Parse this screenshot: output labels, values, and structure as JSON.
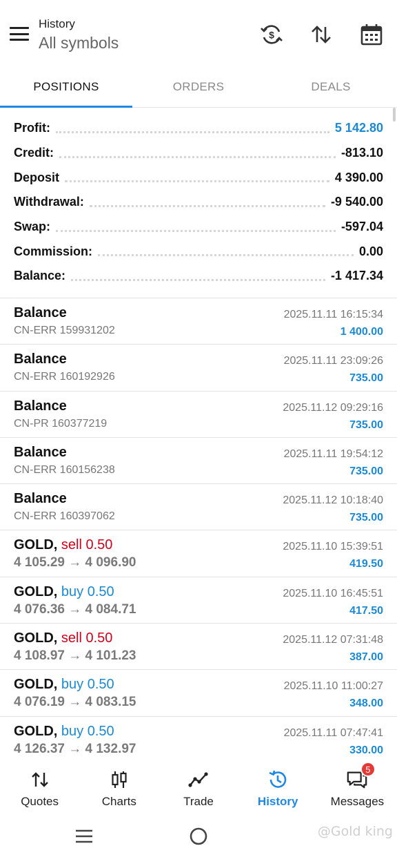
{
  "header": {
    "title": "History",
    "subtitle": "All symbols",
    "icons": [
      "refresh-currency-icon",
      "sort-icon",
      "calendar-icon"
    ]
  },
  "tabs": [
    {
      "label": "POSITIONS",
      "active": true
    },
    {
      "label": "ORDERS",
      "active": false
    },
    {
      "label": "DEALS",
      "active": false
    }
  ],
  "summary": [
    {
      "label": "Profit:",
      "value": "5 142.80",
      "color": "#1b8ad6"
    },
    {
      "label": "Credit:",
      "value": "-813.10"
    },
    {
      "label": "Deposit",
      "value": "4 390.00"
    },
    {
      "label": "Withdrawal:",
      "value": "-9 540.00"
    },
    {
      "label": "Swap:",
      "value": "-597.04"
    },
    {
      "label": "Commission:",
      "value": "0.00"
    },
    {
      "label": "Balance:",
      "value": "-1 417.34"
    }
  ],
  "deals": [
    {
      "title": "Balance",
      "sub": "CN-ERR 159931202",
      "time": "2025.11.11 16:15:34",
      "amount": "1 400.00"
    },
    {
      "title": "Balance",
      "sub": "CN-ERR 160192926",
      "time": "2025.11.11 23:09:26",
      "amount": "735.00"
    },
    {
      "title": "Balance",
      "sub": "CN-PR 160377219",
      "time": "2025.11.12 09:29:16",
      "amount": "735.00"
    },
    {
      "title": "Balance",
      "sub": "CN-ERR 160156238",
      "time": "2025.11.11 19:54:12",
      "amount": "735.00"
    },
    {
      "title": "Balance",
      "sub": "CN-ERR 160397062",
      "time": "2025.11.12 10:18:40",
      "amount": "735.00"
    },
    {
      "symbol": "GOLD,",
      "side": "sell 0.50",
      "side_type": "sell",
      "prices": "4 105.29 → 4 096.90",
      "time": "2025.11.10 15:39:51",
      "amount": "419.50"
    },
    {
      "symbol": "GOLD,",
      "side": "buy 0.50",
      "side_type": "buy",
      "prices": "4 076.36 → 4 084.71",
      "time": "2025.11.10 16:45:51",
      "amount": "417.50"
    },
    {
      "symbol": "GOLD,",
      "side": "sell 0.50",
      "side_type": "sell",
      "prices": "4 108.97 → 4 101.23",
      "time": "2025.11.12 07:31:48",
      "amount": "387.00"
    },
    {
      "symbol": "GOLD,",
      "side": "buy 0.50",
      "side_type": "buy",
      "prices": "4 076.19 → 4 083.15",
      "time": "2025.11.10 11:00:27",
      "amount": "348.00"
    },
    {
      "symbol": "GOLD,",
      "side": "buy 0.50",
      "side_type": "buy",
      "prices": "4 126.37 → 4 132.97",
      "time": "2025.11.11 07:47:41",
      "amount": "330.00"
    }
  ],
  "nav": [
    {
      "label": "Quotes",
      "icon": "quotes-icon"
    },
    {
      "label": "Charts",
      "icon": "charts-icon"
    },
    {
      "label": "Trade",
      "icon": "trade-icon"
    },
    {
      "label": "History",
      "icon": "history-icon",
      "active": true
    },
    {
      "label": "Messages",
      "icon": "messages-icon",
      "badge": "5"
    }
  ],
  "watermark": "@Gold king",
  "colors": {
    "accent": "#1e88e5",
    "profit": "#1b8ad6",
    "sell": "#d0021b",
    "badge": "#e53935"
  }
}
